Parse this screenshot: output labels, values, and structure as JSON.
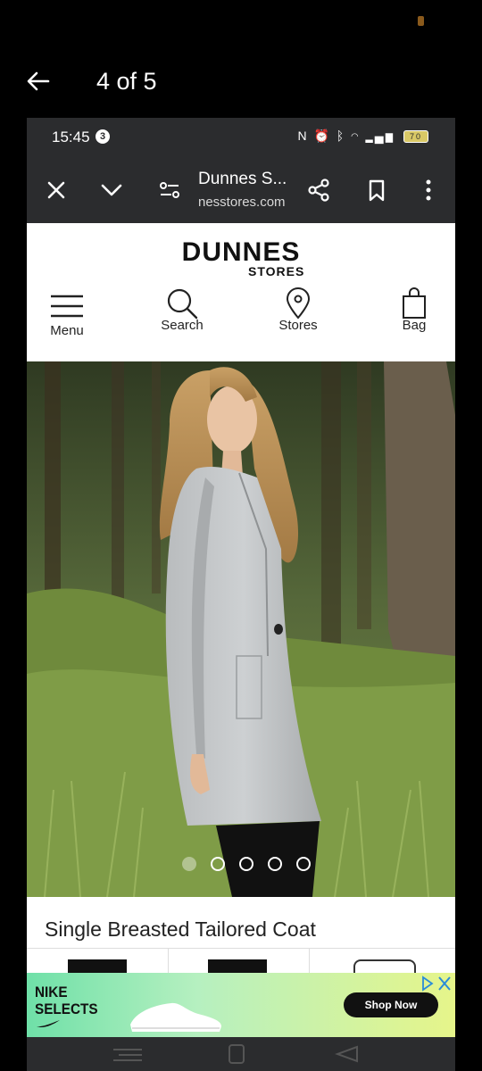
{
  "viewer": {
    "title": "4 of 5"
  },
  "statusbar": {
    "time": "15:45",
    "badge": "3",
    "battery": "70"
  },
  "browser": {
    "page_title": "Dunnes S...",
    "url": "nesstores.com"
  },
  "site": {
    "logo_main": "DUNNES",
    "logo_sub": "STORES",
    "nav": [
      {
        "label": "Menu"
      },
      {
        "label": "Search"
      },
      {
        "label": "Stores"
      },
      {
        "label": "Bag"
      }
    ]
  },
  "carousel": {
    "total_slides": 5,
    "active_index": 0
  },
  "product": {
    "title": "Single Breasted Tailored Coat"
  },
  "ad": {
    "brand_line1": "NIKE",
    "brand_line2": "SELECTS",
    "cta": "Shop Now"
  },
  "colors": {
    "browser_chrome": "#2b2c2e",
    "ad_start": "#6fe0a8",
    "ad_end": "#e6f58a"
  }
}
